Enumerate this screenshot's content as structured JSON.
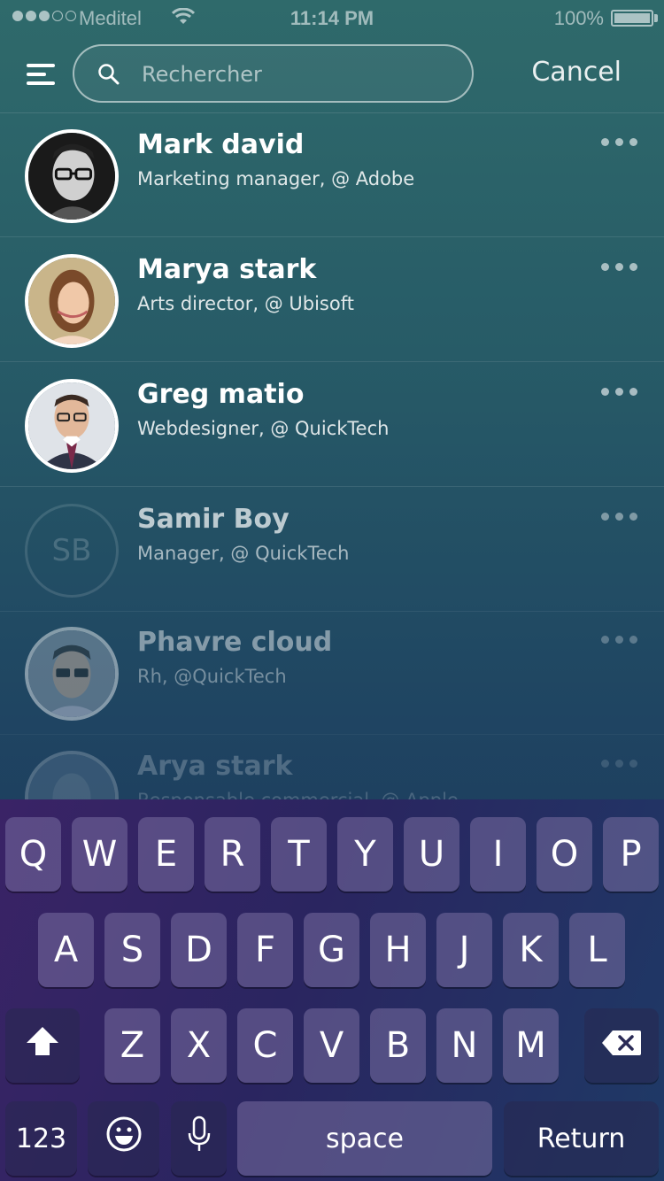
{
  "status_bar": {
    "carrier": "Meditel",
    "time": "11:14 PM",
    "battery": "100%"
  },
  "header": {
    "search_placeholder": "Rechercher",
    "cancel_label": "Cancel"
  },
  "contacts": [
    {
      "name": "Mark david",
      "title": "Marketing manager, @ Adobe",
      "avatar": "photo-man-glasses"
    },
    {
      "name": "Marya stark",
      "title": "Arts director, @ Ubisoft",
      "avatar": "photo-woman"
    },
    {
      "name": "Greg matio",
      "title": "Webdesigner, @ QuickTech",
      "avatar": "photo-man-suit"
    },
    {
      "name": "Samir Boy",
      "title": "Manager, @ QuickTech",
      "avatar_initials": "SB"
    },
    {
      "name": "Phavre cloud",
      "title": "Rh, @QuickTech",
      "avatar": "photo-man-glasses-2"
    },
    {
      "name": "Arya stark",
      "title": "Responsable commercial, @ Apple",
      "avatar": "photo-faded"
    }
  ],
  "keyboard": {
    "row1": [
      "Q",
      "W",
      "E",
      "R",
      "T",
      "Y",
      "U",
      "I",
      "O",
      "P"
    ],
    "row2": [
      "A",
      "S",
      "D",
      "F",
      "G",
      "H",
      "J",
      "K",
      "L"
    ],
    "row3": [
      "Z",
      "X",
      "C",
      "V",
      "B",
      "N",
      "M"
    ],
    "numbers_label": "123",
    "space_label": "space",
    "return_label": "Return"
  }
}
